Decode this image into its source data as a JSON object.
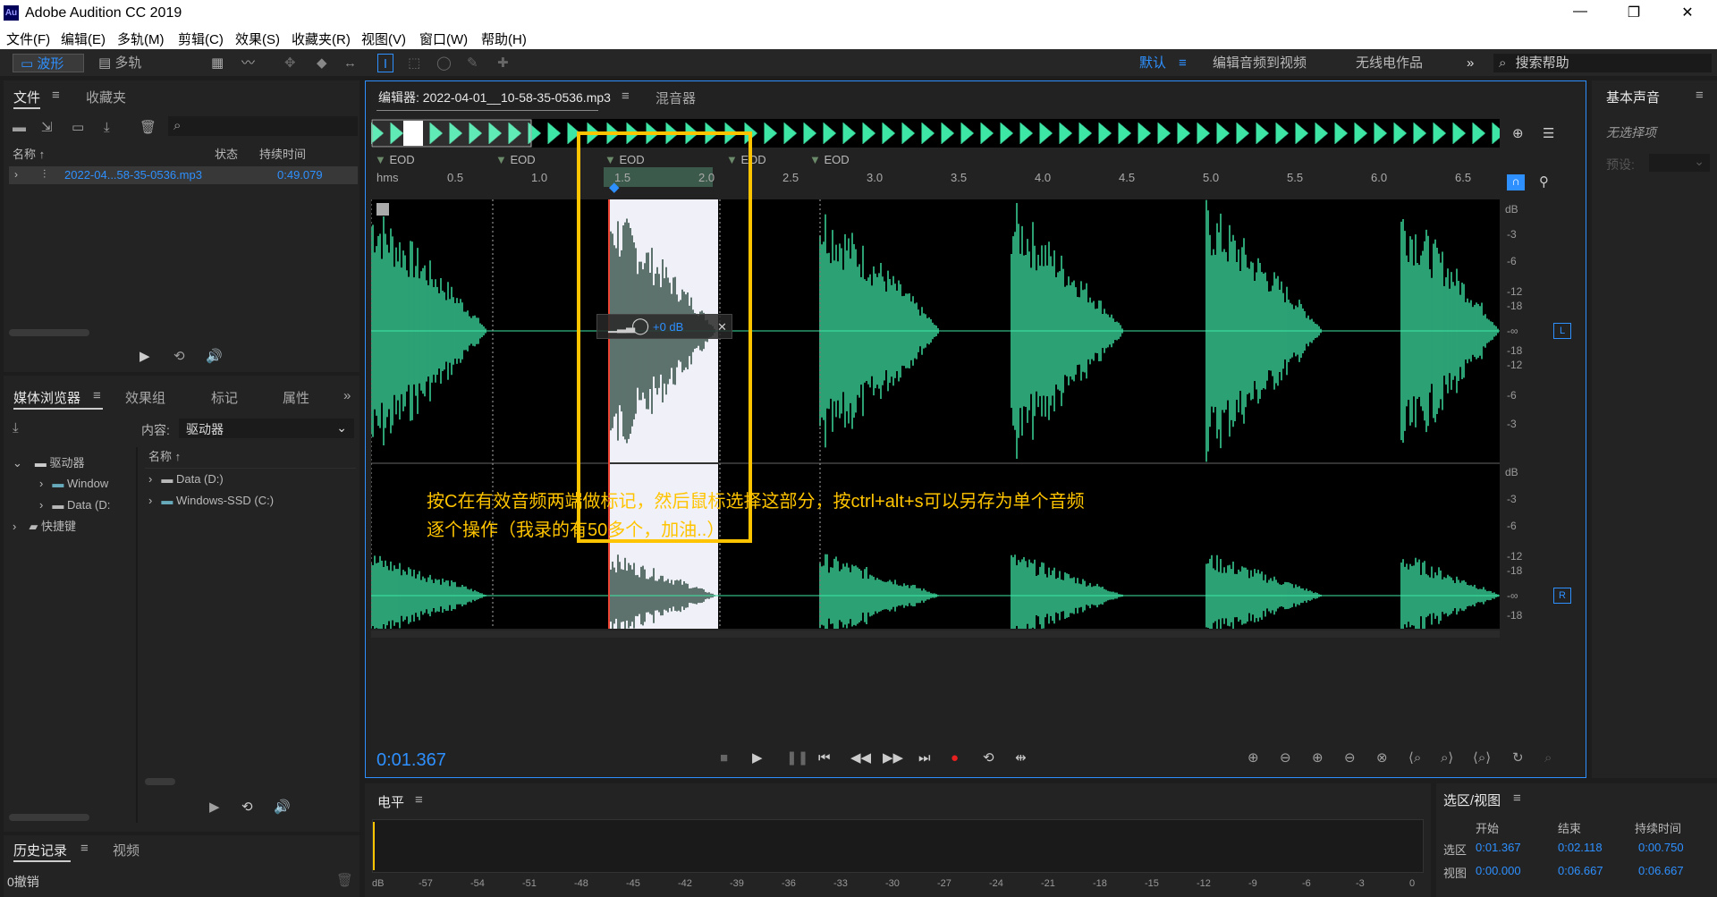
{
  "app": {
    "title": "Adobe Audition CC 2019",
    "logo": "Au"
  },
  "menu": [
    "文件(F)",
    "编辑(E)",
    "多轨(M)",
    "剪辑(C)",
    "效果(S)",
    "收藏夹(R)",
    "视图(V)",
    "窗口(W)",
    "帮助(H)"
  ],
  "toolbar": {
    "waveform": "波形",
    "multitrack": "多轨",
    "workspace": "默认",
    "ws2": "编辑音频到视频",
    "ws3": "无线电作品",
    "search_placeholder": "搜索帮助"
  },
  "files": {
    "tab1": "文件",
    "tab2": "收藏夹",
    "col_name": "名称 ↑",
    "col_status": "状态",
    "col_dur": "持续时间",
    "file_name": "2022-04...58-35-0536.mp3",
    "file_dur": "0:49.079"
  },
  "media": {
    "tab1": "媒体浏览器",
    "tab2": "效果组",
    "tab3": "标记",
    "tab4": "属性",
    "content_label": "内容:",
    "content_value": "驱动器",
    "tree": [
      "驱动器",
      "Window",
      "Data (D:",
      "快捷键"
    ],
    "col_name": "名称 ↑",
    "items": [
      "Data (D:)",
      "Windows-SSD (C:)"
    ]
  },
  "history": {
    "tab1": "历史记录",
    "tab2": "视频",
    "entry": "0撤销"
  },
  "editor": {
    "tab": "编辑器: 2022-04-01__10-58-35-0536.mp3",
    "mixer": "混音器",
    "time": "0:01.367",
    "marker": "EOD",
    "gain": "+0 dB",
    "ch_left": "L",
    "ch_right": "R",
    "ruler_unit": "hms",
    "ruler": [
      "0.5",
      "1.0",
      "1.5",
      "2.0",
      "2.5",
      "3.0",
      "3.5",
      "4.0",
      "4.5",
      "5.0",
      "5.5",
      "6.0",
      "6.5"
    ],
    "db_scale": [
      "dB",
      "-3",
      "-6",
      "-12",
      "-18",
      "-∞",
      "-18",
      "-12",
      "-6",
      "-3"
    ]
  },
  "annotation": {
    "line1": "按C在有效音频两端做标记，然后鼠标选择这部分，按ctrl+alt+s可以另存为单个音频",
    "line2": "逐个操作（我录的有50多个，加油..）"
  },
  "right": {
    "title": "基本声音",
    "none": "无选择项",
    "preset": "预设:"
  },
  "level": {
    "title": "电平",
    "scale": [
      "dB",
      "-57",
      "-54",
      "-51",
      "-48",
      "-45",
      "-42",
      "-39",
      "-36",
      "-33",
      "-30",
      "-27",
      "-24",
      "-21",
      "-18",
      "-15",
      "-12",
      "-9",
      "-6",
      "-3",
      "0"
    ]
  },
  "selview": {
    "title": "选区/视图",
    "h_start": "开始",
    "h_end": "结束",
    "h_dur": "持续时间",
    "r1": "选区",
    "r1_start": "0:01.367",
    "r1_end": "0:02.118",
    "r1_dur": "0:00.750",
    "r2": "视图",
    "r2_start": "0:00.000",
    "r2_end": "0:06.667",
    "r2_dur": "0:06.667"
  },
  "colors": {
    "wave": "#3ee6a6",
    "accent": "#2e90ff",
    "annotation": "#ffc400"
  }
}
